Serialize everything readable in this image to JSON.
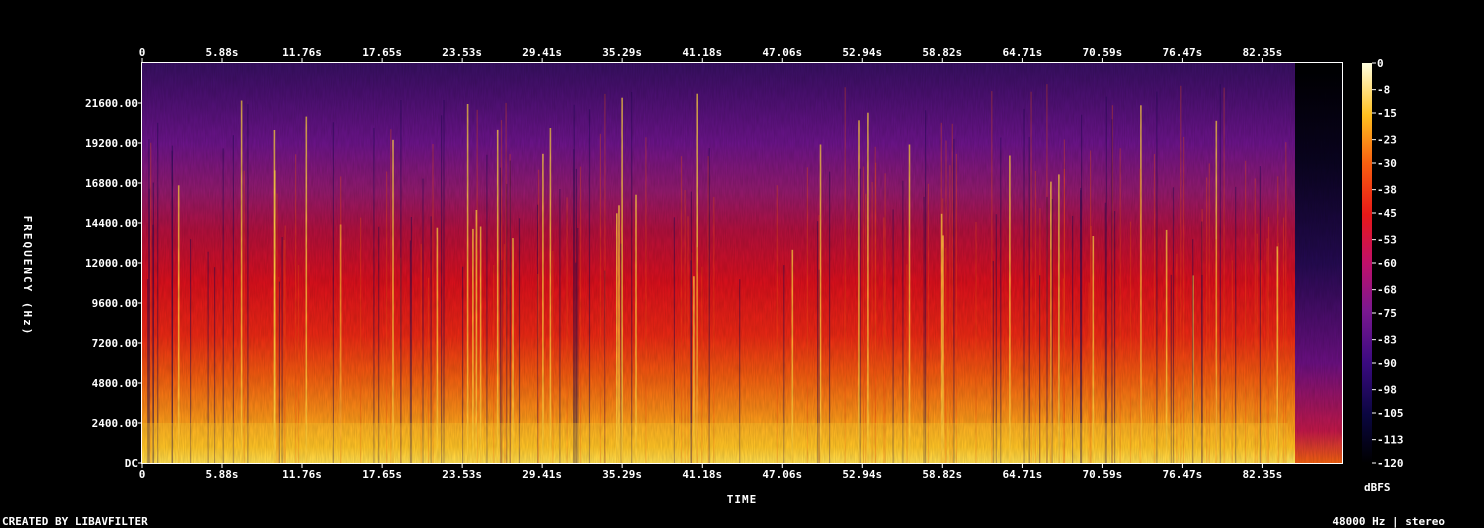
{
  "chart_data": {
    "type": "heatmap",
    "title": "",
    "xlabel": "TIME",
    "ylabel": "FREQUENCY (Hz)",
    "x_ticks": [
      "0",
      "5.88s",
      "11.76s",
      "17.65s",
      "23.53s",
      "29.41s",
      "35.29s",
      "41.18s",
      "47.06s",
      "52.94s",
      "58.82s",
      "64.71s",
      "70.59s",
      "76.47s",
      "82.35s"
    ],
    "x_tick_values": [
      0,
      5.88,
      11.76,
      17.65,
      23.53,
      29.41,
      35.29,
      41.18,
      47.06,
      52.94,
      58.82,
      64.71,
      70.59,
      76.47,
      82.35
    ],
    "xlim": [
      0,
      88.2
    ],
    "y_ticks": [
      "DC",
      "2400.00",
      "4800.00",
      "7200.00",
      "9600.00",
      "12000.00",
      "14400.00",
      "16800.00",
      "19200.00",
      "21600.00"
    ],
    "y_tick_values": [
      0,
      2400,
      4800,
      7200,
      9600,
      12000,
      14400,
      16800,
      19200,
      21600
    ],
    "ylim": [
      0,
      24000
    ],
    "colorbar": {
      "label": "dBFS",
      "ticks": [
        "0",
        "-8",
        "-15",
        "-23",
        "-30",
        "-38",
        "-45",
        "-53",
        "-60",
        "-68",
        "-75",
        "-83",
        "-90",
        "-98",
        "-105",
        "-113",
        "-120"
      ],
      "tick_values": [
        0,
        -8,
        -15,
        -23,
        -30,
        -38,
        -45,
        -53,
        -60,
        -68,
        -75,
        -83,
        -90,
        -98,
        -105,
        -113,
        -120
      ],
      "range": [
        -120,
        0
      ]
    },
    "colors": {
      "background": "#000000",
      "text": "#ffffff",
      "high": "#ffffc0",
      "mid": "#e01818",
      "low": "#400080",
      "floor": "#000010"
    },
    "approx_levels_dbfs": {
      "low_band": -30,
      "mid_band": -55,
      "high_band": -85,
      "tail_after_s": 84.2
    },
    "footer_left": "CREATED BY LIBAVFILTER",
    "footer_right": "48000 Hz | stereo"
  }
}
